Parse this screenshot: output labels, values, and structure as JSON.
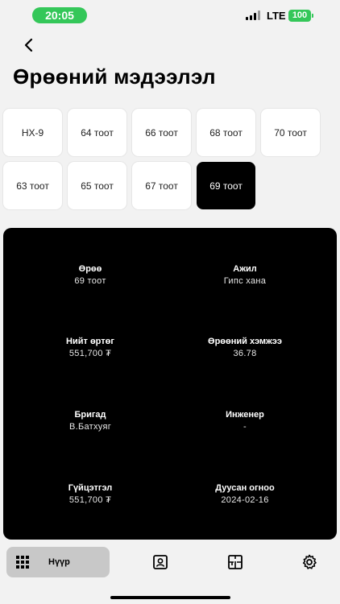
{
  "status_bar": {
    "time": "20:05",
    "network": "LTE",
    "battery": "100",
    "colors": {
      "accent": "#34c759"
    }
  },
  "header": {
    "back_icon": "chevron-left-icon",
    "title": "Өрөөний мэдээлэл"
  },
  "rooms": [
    {
      "label": "НХ-9",
      "selected": false
    },
    {
      "label": "64 тоот",
      "selected": false
    },
    {
      "label": "66 тоот",
      "selected": false
    },
    {
      "label": "68 тоот",
      "selected": false
    },
    {
      "label": "70 тоот",
      "selected": false
    },
    {
      "label": "63 тоот",
      "selected": false
    },
    {
      "label": "65 тоот",
      "selected": false
    },
    {
      "label": "67 тоот",
      "selected": false
    },
    {
      "label": "69 тоот",
      "selected": true
    }
  ],
  "details": {
    "room": {
      "label": "Өрөө",
      "value": "69 тоот"
    },
    "work": {
      "label": "Ажил",
      "value": "Гипс хана"
    },
    "total_cost": {
      "label": "Нийт өртөг",
      "value": "551,700 ₮"
    },
    "room_size": {
      "label": "Өрөөний хэмжээ",
      "value": "36.78"
    },
    "brigade": {
      "label": "Бригад",
      "value": "В.Батхуяг"
    },
    "engineer": {
      "label": "Инженер",
      "value": "-"
    },
    "performance": {
      "label": "Гүйцэтгэл",
      "value": "551,700 ₮"
    },
    "end_date": {
      "label": "Дуусан огноо",
      "value": "2024-02-16"
    }
  },
  "tab_bar": {
    "home_label": "Нүүр",
    "icons": [
      "grid-icon",
      "contact-card-icon",
      "floor-plan-icon",
      "gear-icon"
    ]
  }
}
